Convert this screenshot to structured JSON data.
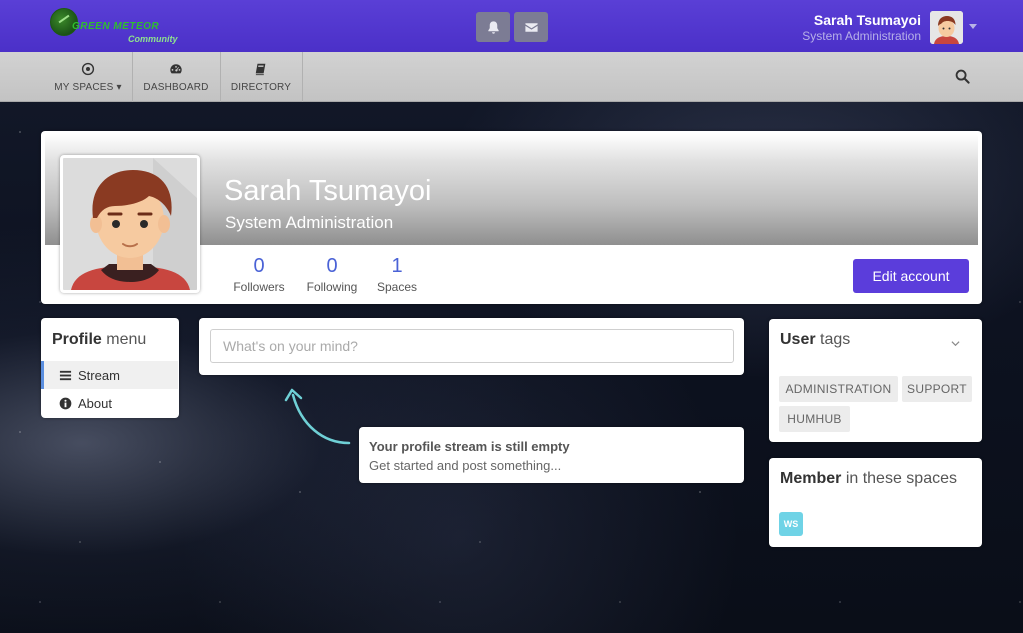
{
  "header": {
    "logo_text": "GREEN METEOR",
    "logo_sub": "Community",
    "user_name": "Sarah Tsumayoi",
    "user_title": "System Administration",
    "notifications_icon": "bell-icon",
    "messages_icon": "envelope-icon"
  },
  "nav": {
    "items": [
      {
        "label": "MY SPACES",
        "icon": "target-icon"
      },
      {
        "label": "DASHBOARD",
        "icon": "gauge-icon"
      },
      {
        "label": "DIRECTORY",
        "icon": "book-icon"
      }
    ],
    "search_icon": "search-icon"
  },
  "profile": {
    "name": "Sarah Tsumayoi",
    "title": "System Administration",
    "stats": [
      {
        "value": "0",
        "label": "Followers"
      },
      {
        "value": "0",
        "label": "Following"
      },
      {
        "value": "1",
        "label": "Spaces"
      }
    ],
    "edit_button": "Edit account"
  },
  "profile_menu": {
    "title_bold": "Profile",
    "title_rest": "menu",
    "items": [
      {
        "label": "Stream",
        "icon": "bars-icon",
        "active": true
      },
      {
        "label": "About",
        "icon": "info-circle-icon",
        "active": false
      }
    ]
  },
  "composer": {
    "placeholder": "What's on your mind?"
  },
  "empty_stream": {
    "title": "Your profile stream is still empty",
    "subtitle": "Get started and post something..."
  },
  "user_tags": {
    "title_bold": "User",
    "title_rest": "tags",
    "tags": [
      "ADMINISTRATION",
      "SUPPORT",
      "HUMHUB"
    ]
  },
  "member_spaces": {
    "title_bold": "Member",
    "title_rest": "in these spaces",
    "spaces": [
      {
        "abbr": "WS",
        "color": "#6fd3e6"
      }
    ]
  },
  "colors": {
    "header": "#5a3fd6",
    "accent": "#5b3ddb",
    "stat_number": "#4a62d6"
  }
}
